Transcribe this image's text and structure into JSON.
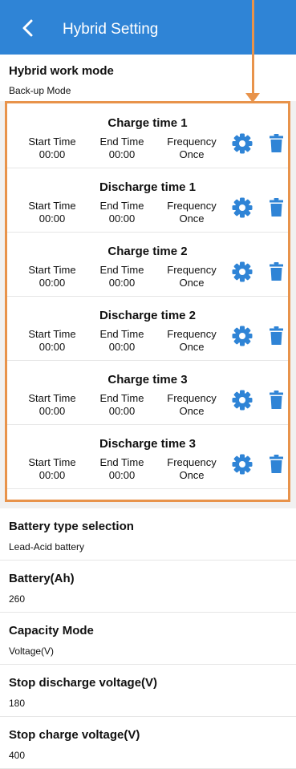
{
  "header": {
    "title": "Hybrid Setting"
  },
  "work_mode": {
    "title": "Hybrid work mode",
    "value": "Back-up Mode"
  },
  "slots": [
    {
      "title": "Charge time 1",
      "start_label": "Start Time",
      "start_value": "00:00",
      "end_label": "End Time",
      "end_value": "00:00",
      "freq_label": "Frequency",
      "freq_value": "Once"
    },
    {
      "title": "Discharge time 1",
      "start_label": "Start Time",
      "start_value": "00:00",
      "end_label": "End Time",
      "end_value": "00:00",
      "freq_label": "Frequency",
      "freq_value": "Once"
    },
    {
      "title": "Charge time 2",
      "start_label": "Start Time",
      "start_value": "00:00",
      "end_label": "End Time",
      "end_value": "00:00",
      "freq_label": "Frequency",
      "freq_value": "Once"
    },
    {
      "title": "Discharge time 2",
      "start_label": "Start Time",
      "start_value": "00:00",
      "end_label": "End Time",
      "end_value": "00:00",
      "freq_label": "Frequency",
      "freq_value": "Once"
    },
    {
      "title": "Charge time 3",
      "start_label": "Start Time",
      "start_value": "00:00",
      "end_label": "End Time",
      "end_value": "00:00",
      "freq_label": "Frequency",
      "freq_value": "Once"
    },
    {
      "title": "Discharge time 3",
      "start_label": "Start Time",
      "start_value": "00:00",
      "end_label": "End Time",
      "end_value": "00:00",
      "freq_label": "Frequency",
      "freq_value": "Once"
    }
  ],
  "settings": [
    {
      "title": "Battery type selection",
      "value": "Lead-Acid battery"
    },
    {
      "title": "Battery(Ah)",
      "value": "260"
    },
    {
      "title": "Capacity Mode",
      "value": "Voltage(V)"
    },
    {
      "title": "Stop discharge voltage(V)",
      "value": "180"
    },
    {
      "title": "Stop charge voltage(V)",
      "value": "400"
    }
  ],
  "colors": {
    "header": "#2f84d6",
    "icon": "#2f84d6",
    "highlight": "#e8934b",
    "page_bg": "#f1f1f1"
  },
  "icons": {
    "back": "chevron-left-icon",
    "edit": "gear-icon",
    "delete": "trash-icon"
  }
}
